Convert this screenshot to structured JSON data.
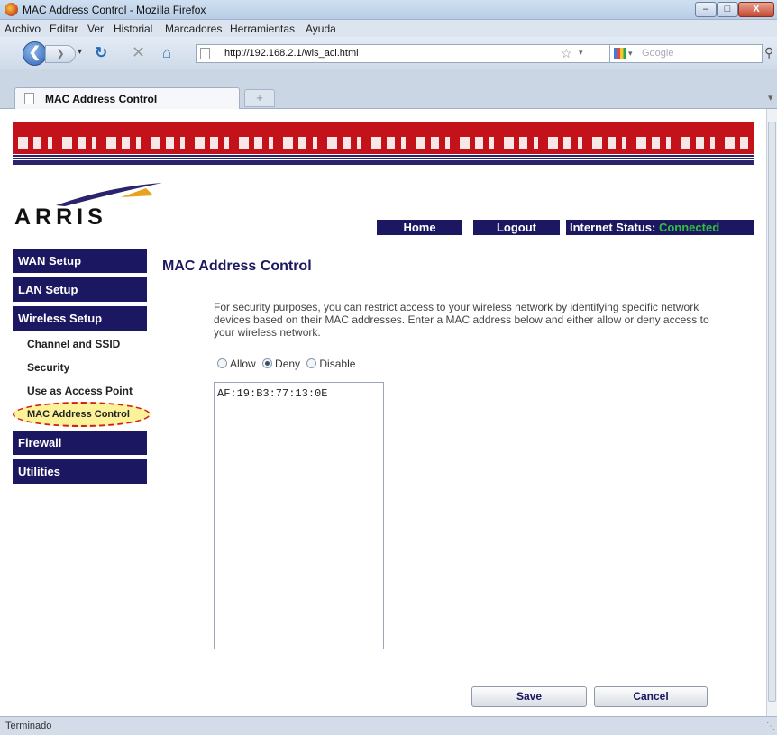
{
  "window": {
    "title": "MAC Address Control - Mozilla Firefox",
    "minimize": "–",
    "maximize": "□",
    "close": "X"
  },
  "menu": [
    "Archivo",
    "Editar",
    "Ver",
    "Historial",
    "Marcadores",
    "Herramientas",
    "Ayuda"
  ],
  "navbar": {
    "url": "http://192.168.2.1/wls_acl.html",
    "search_placeholder": "Google"
  },
  "tabs": {
    "active_label": "MAC Address Control",
    "new_tab": "+"
  },
  "header": {
    "logo_text": "ARRIS",
    "home_label": "Home",
    "logout_label": "Logout",
    "status_label": "Internet Status:",
    "status_value": "Connected",
    "status_color": "#31c03c"
  },
  "sidebar": {
    "wan": "WAN Setup",
    "lan": "LAN Setup",
    "wireless": "Wireless Setup",
    "sub": [
      "Channel and SSID",
      "Security",
      "Use as Access Point",
      "MAC Address Control"
    ],
    "firewall": "Firewall",
    "utilities": "Utilities"
  },
  "main": {
    "heading": "MAC Address Control",
    "description": "For security purposes, you can restrict access to your wireless network by identifying specific network devices based on their MAC addresses. Enter a MAC address below and either allow or deny access to your wireless network.",
    "mode_options": [
      "Allow",
      "Deny",
      "Disable"
    ],
    "mode_selected": "Deny",
    "mac_list": "AF:19:B3:77:13:0E",
    "save_label": "Save",
    "cancel_label": "Cancel"
  },
  "statusbar": {
    "text": "Terminado"
  },
  "colors": {
    "navy": "#1b1760",
    "banner_red": "#c4121a",
    "highlight_fill": "#fbf29a",
    "highlight_border": "#d31e1e"
  }
}
